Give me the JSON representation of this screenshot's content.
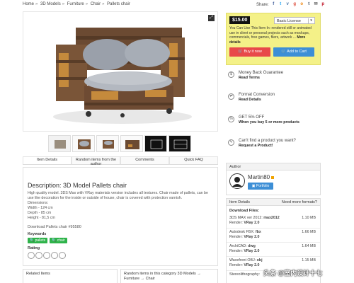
{
  "breadcrumb": [
    "Home",
    "3D Models",
    "Furniture",
    "Chair",
    "Pallets chair"
  ],
  "share_label": "Share:",
  "share_icons": [
    "facebook-icon",
    "twitter-icon",
    "vk-icon",
    "google-plus-icon",
    "odnoklassniki-icon",
    "tumblr-icon",
    "email-icon",
    "pinterest-icon"
  ],
  "tabs": [
    "Item Details",
    "Random items from the author",
    "Comments",
    "Quick FAQ"
  ],
  "description": {
    "title": "Description: 3D Model Pallets chair",
    "text": "High quality model. 3DS Max with VRay materials version includes all textures. Chair made of pallets, can be use like decoration for the inside or outside of house, chair is covered with protection varnish.",
    "dimensions_label": "Dimensions:",
    "dims": [
      "Width - 124 cm",
      "Depth - 85 cm",
      "Height - 81,5 cm"
    ],
    "download_link": "Download Pallets chair #95580",
    "keywords_label": "Keywords",
    "keywords": [
      "pallets",
      "chair"
    ],
    "rating_label": "Rating"
  },
  "related": {
    "left_title": "Related Items",
    "right_title": "Random items in this category 3D Models → Furniture → Chair"
  },
  "buy": {
    "price": "$15.00",
    "license": "Basic License",
    "text": "You Can Use This Item In: rendered still or animated use in client or personal projects such as mockups, commercials, free games, fliers, artwork ...",
    "more": "More details",
    "buy_now": "Buy it now",
    "add_to_cart": "Add to Cart"
  },
  "features": [
    {
      "icon": "money-back-icon",
      "title": "Money Back Guarantee",
      "sub": "Read Terms"
    },
    {
      "icon": "format-conversion-icon",
      "title": "Format Conversion",
      "sub": "Read Details"
    },
    {
      "icon": "discount-icon",
      "title": "GET 5% OFF",
      "sub": "When you buy 5 or more products"
    },
    {
      "icon": "request-icon",
      "title": "Can't find a product you want?",
      "sub": "Request a Product!"
    }
  ],
  "author": {
    "head": "Author",
    "name": "Martin80",
    "portfolio": "Portfolio"
  },
  "items": {
    "head": "Item Details",
    "more_formats": "Need more formats?",
    "download_files": "Download Files:",
    "files": [
      {
        "name": "3DS MAX ver 2012:",
        "version": "max2012",
        "render": "Render:",
        "render_value": "VRay 2.0",
        "size": "1.10 MB"
      },
      {
        "name": "Autodesk FBX:",
        "version": "fbx",
        "render": "Render:",
        "render_value": "VRay 2.0",
        "size": "1.66 MB"
      },
      {
        "name": "ArchiCAD:",
        "version": "dwg",
        "render": "Render:",
        "render_value": "VRay 2.0",
        "size": "1.64 MB"
      },
      {
        "name": "Wavefront OBJ:",
        "version": "obj",
        "render": "Render:",
        "render_value": "VRay 2.0",
        "size": "1.15 MB"
      },
      {
        "name": "Stereolithography:",
        "version": "",
        "render": "",
        "render_value": "",
        "size": ""
      }
    ]
  },
  "watermark": "头条 @室内设计十七",
  "colors": {
    "price_bg": "#111111",
    "buy_box": "#f4f188",
    "buy_btn": "#e8494a",
    "cart_btn": "#3d8fd6",
    "keyword": "#2eb34a"
  }
}
